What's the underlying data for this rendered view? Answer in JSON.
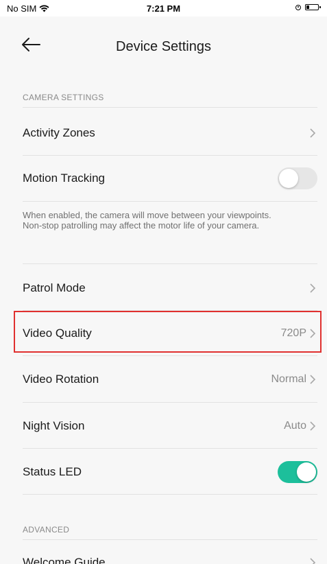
{
  "status_bar": {
    "carrier": "No SIM",
    "time": "7:21 PM"
  },
  "nav": {
    "title": "Device Settings",
    "back_icon": "arrow-left-icon"
  },
  "sections": {
    "camera_settings_header": "CAMERA SETTINGS",
    "advanced_header": "ADVANCED"
  },
  "rows": {
    "activity_zones": {
      "label": "Activity Zones"
    },
    "motion_tracking": {
      "label": "Motion Tracking",
      "enabled": false,
      "help": "When enabled, the camera will move between your viewpoints. Non-stop patrolling may affect the motor life of your camera."
    },
    "patrol_mode": {
      "label": "Patrol Mode"
    },
    "video_quality": {
      "label": "Video Quality",
      "value": "720P"
    },
    "video_rotation": {
      "label": "Video Rotation",
      "value": "Normal"
    },
    "night_vision": {
      "label": "Night Vision",
      "value": "Auto"
    },
    "status_led": {
      "label": "Status LED",
      "enabled": true
    },
    "welcome_guide": {
      "label": "Welcome Guide"
    }
  },
  "colors": {
    "toggle_on": "#1dbf9b",
    "toggle_off": "#e6e6e6",
    "highlight": "#e0302f"
  }
}
